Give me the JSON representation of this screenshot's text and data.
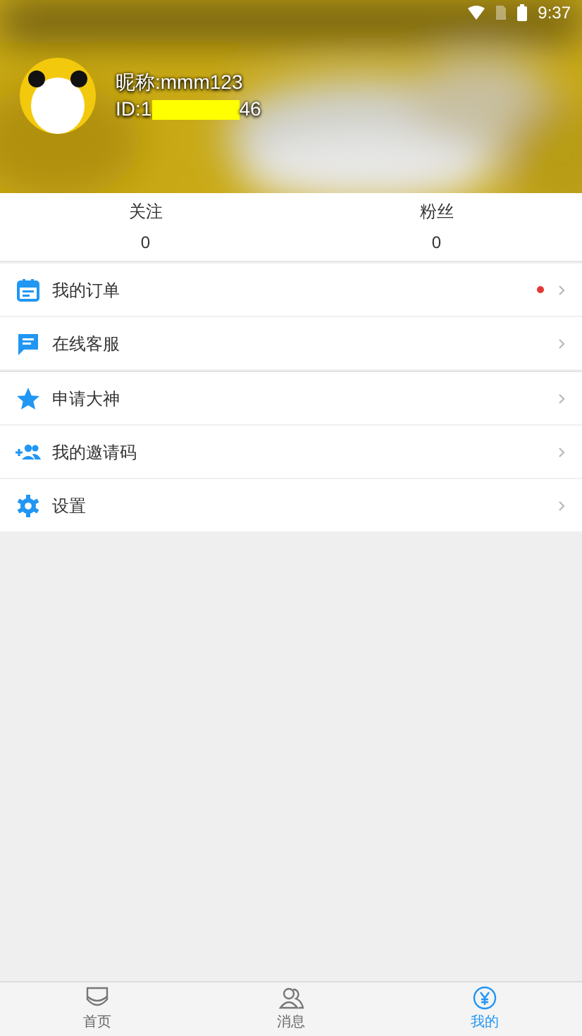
{
  "status_bar": {
    "time": "9:37"
  },
  "profile": {
    "nickname": "昵称:mmm123",
    "id_prefix": "ID:1",
    "id_suffix": "46"
  },
  "stats": [
    {
      "label": "关注",
      "value": "0"
    },
    {
      "label": "粉丝",
      "value": "0"
    }
  ],
  "menu": [
    {
      "label": "我的订单",
      "has_dot": true
    },
    {
      "label": "在线客服",
      "has_dot": false
    },
    {
      "label": "申请大神",
      "has_dot": false
    },
    {
      "label": "我的邀请码",
      "has_dot": false
    },
    {
      "label": "设置",
      "has_dot": false
    }
  ],
  "tab_bar": [
    {
      "label": "首页",
      "selected": false
    },
    {
      "label": "消息",
      "selected": false
    },
    {
      "label": "我的",
      "selected": true
    }
  ]
}
